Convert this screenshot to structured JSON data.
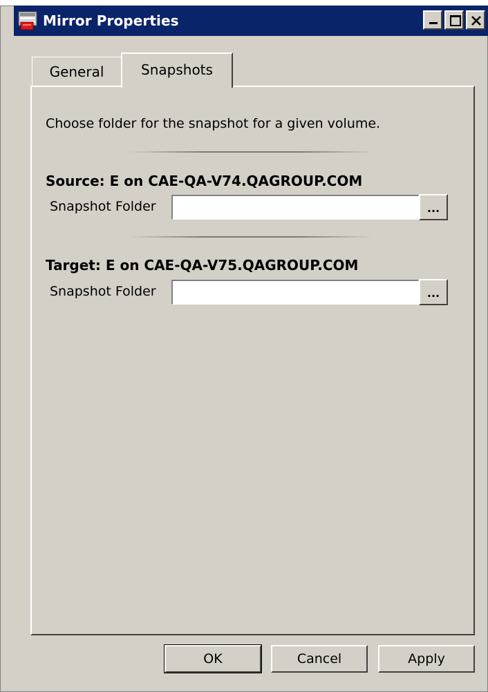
{
  "window": {
    "title": "Mirror Properties",
    "title_bar_color": "#0a246a",
    "controls": [
      "minimize",
      "maximize",
      "close"
    ]
  },
  "tabs": [
    {
      "label": "General",
      "selected": false
    },
    {
      "label": "Snapshots",
      "selected": true
    }
  ],
  "snapshots": {
    "description": "Choose folder for the snapshot for a given volume.",
    "source": {
      "title": "Source: E on CAE-QA-V74.QAGROUP.COM",
      "field_label": "Snapshot Folder",
      "value": "",
      "browse_label": "..."
    },
    "target": {
      "title": "Target: E on CAE-QA-V75.QAGROUP.COM",
      "field_label": "Snapshot Folder",
      "value": "",
      "browse_label": "..."
    }
  },
  "buttons": {
    "ok": "OK",
    "cancel": "Cancel",
    "apply": "Apply"
  }
}
